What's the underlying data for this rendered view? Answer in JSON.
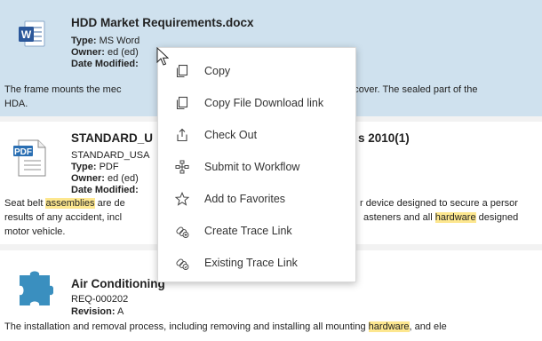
{
  "results": [
    {
      "title": "HDD Market Requirements.docx",
      "icon": "word-document-icon",
      "type_label": "Type:",
      "type_value": "MS Word",
      "owner_label": "Owner:",
      "owner_value": "ed (ed)",
      "date_label": "Date Modified:",
      "snippet_left_1": "The frame mounts the mec",
      "snippet_right_1": "with a cover.  The sealed part of the",
      "snippet_2": "HDA."
    },
    {
      "title_left": "STANDARD_U",
      "title_right": "s 2010(1)",
      "icon": "pdf-document-icon",
      "subtitle": "STANDARD_USA",
      "type_label": "Type:",
      "type_value": "PDF",
      "owner_label": "Owner:",
      "owner_value": "ed (ed)",
      "date_label": "Date Modified:",
      "s1_a": "Seat belt ",
      "s1_hl": "assemblies",
      "s1_b": " are de",
      "s1_right": "r device designed to secure a persor",
      "s2_left": "results of any accident, incl",
      "s2_right_a": "asteners and all ",
      "s2_right_hl": "hardware",
      "s2_right_b": " designed",
      "s3": "motor vehicle."
    },
    {
      "title": "Air Conditioning",
      "icon": "puzzle-piece-icon",
      "subtitle": "REQ-000202",
      "revision_label": "Revision:",
      "revision_value": "A",
      "s1_a": "The installation and removal process, including removing and installing all mounting ",
      "s1_hl": "hardware",
      "s1_b": ", and ele"
    }
  ],
  "context_menu": {
    "items": [
      {
        "label": "Copy",
        "icon": "copy-icon"
      },
      {
        "label": "Copy File Download link",
        "icon": "copy-link-icon"
      },
      {
        "label": "Check Out",
        "icon": "check-out-icon"
      },
      {
        "label": "Submit to Workflow",
        "icon": "workflow-icon"
      },
      {
        "label": "Add to Favorites",
        "icon": "star-icon"
      },
      {
        "label": "Create Trace Link",
        "icon": "create-trace-link-icon"
      },
      {
        "label": "Existing Trace Link",
        "icon": "existing-trace-link-icon"
      }
    ]
  },
  "colors": {
    "selected_row": "#cfe1ee",
    "highlight": "#fde78f",
    "word_blue": "#2b579a",
    "pdf_blue": "#2a6fb3",
    "puzzle_blue": "#3a8fbf"
  }
}
